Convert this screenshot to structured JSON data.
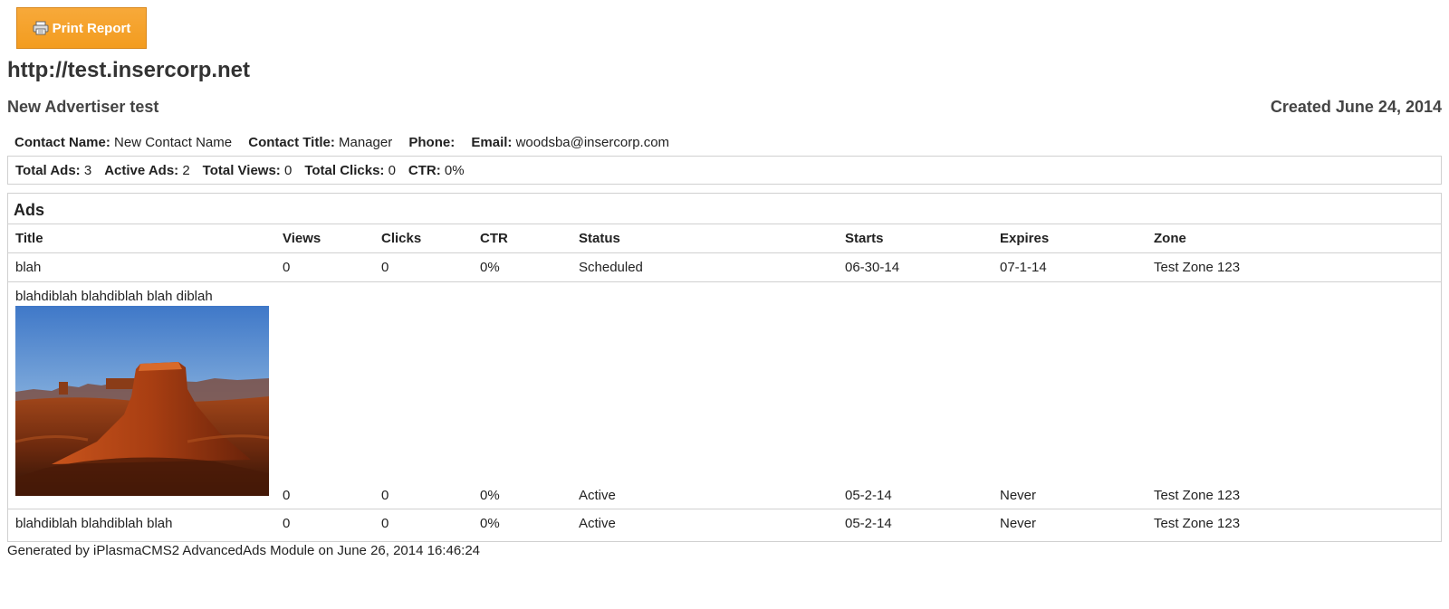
{
  "toolbar": {
    "print_label": "Print Report",
    "print_icon": "printer-icon"
  },
  "site": {
    "url": "http://test.insercorp.net"
  },
  "advertiser": {
    "name": "New Advertiser test",
    "created": "Created June 24, 2014"
  },
  "contact": {
    "name_label": "Contact Name:",
    "name_value": "New Contact Name",
    "title_label": "Contact Title:",
    "title_value": "Manager",
    "phone_label": "Phone:",
    "phone_value": "",
    "email_label": "Email:",
    "email_value": "woodsba@insercorp.com"
  },
  "stats": {
    "total_ads_label": "Total Ads:",
    "total_ads": "3",
    "active_ads_label": "Active Ads:",
    "active_ads": "2",
    "total_views_label": "Total Views:",
    "total_views": "0",
    "total_clicks_label": "Total Clicks:",
    "total_clicks": "0",
    "ctr_label": "CTR:",
    "ctr": "0%"
  },
  "ads": {
    "heading": "Ads",
    "columns": [
      "Title",
      "Views",
      "Clicks",
      "CTR",
      "Status",
      "Starts",
      "Expires",
      "Zone"
    ],
    "rows": [
      {
        "title": "blah",
        "views": "0",
        "clicks": "0",
        "ctr": "0%",
        "status": "Scheduled",
        "starts": "06-30-14",
        "expires": "07-1-14",
        "zone": "Test Zone 123"
      },
      {
        "title": "blahdiblah blahdiblah blah diblah",
        "views": "0",
        "clicks": "0",
        "ctr": "0%",
        "status": "Active",
        "starts": "05-2-14",
        "expires": "Never",
        "zone": "Test Zone 123",
        "image": "desert-butte-image"
      },
      {
        "title": "blahdiblah blahdiblah blah",
        "views": "0",
        "clicks": "0",
        "ctr": "0%",
        "status": "Active",
        "starts": "05-2-14",
        "expires": "Never",
        "zone": "Test Zone 123"
      }
    ]
  },
  "footer": {
    "text": "Generated by iPlasmaCMS2 AdvancedAds Module on June 26, 2014 16:46:24"
  },
  "colors": {
    "button": "#f39c1f",
    "border": "#d0d0d0"
  }
}
